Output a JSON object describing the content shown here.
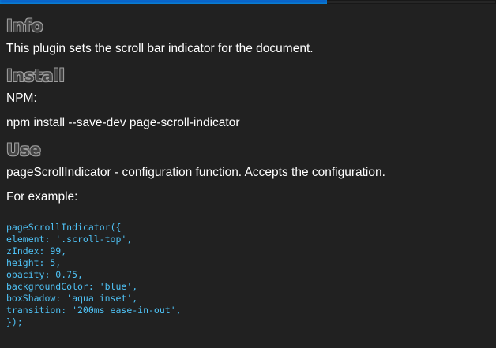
{
  "scroll_indicator": {
    "progress": 0.66,
    "fill_color": "#0a63c9",
    "track_color": "#262626"
  },
  "sections": {
    "info": {
      "heading": "Info",
      "text": "This plugin sets the scroll bar indicator for the document."
    },
    "install": {
      "heading": "Install",
      "label": "NPM:",
      "command": "npm install --save-dev page-scroll-indicator"
    },
    "use": {
      "heading": "Use",
      "text": "pageScrollIndicator - configuration function. Accepts the configuration.",
      "example_label": "For example:",
      "code_lines": [
        "pageScrollIndicator({",
        "element: '.scroll-top',",
        "zIndex: 99,",
        "height: 5,",
        "opacity: 0.75,",
        "backgroundColor: 'blue',",
        "boxShadow: 'aqua inset',",
        "transition: '200ms ease-in-out',",
        "});"
      ]
    }
  },
  "colors": {
    "background": "#212121",
    "text": "#ffffff",
    "heading_fill": "#424242",
    "heading_outline": "#9e9e9e",
    "code": "#4fc3f7"
  }
}
